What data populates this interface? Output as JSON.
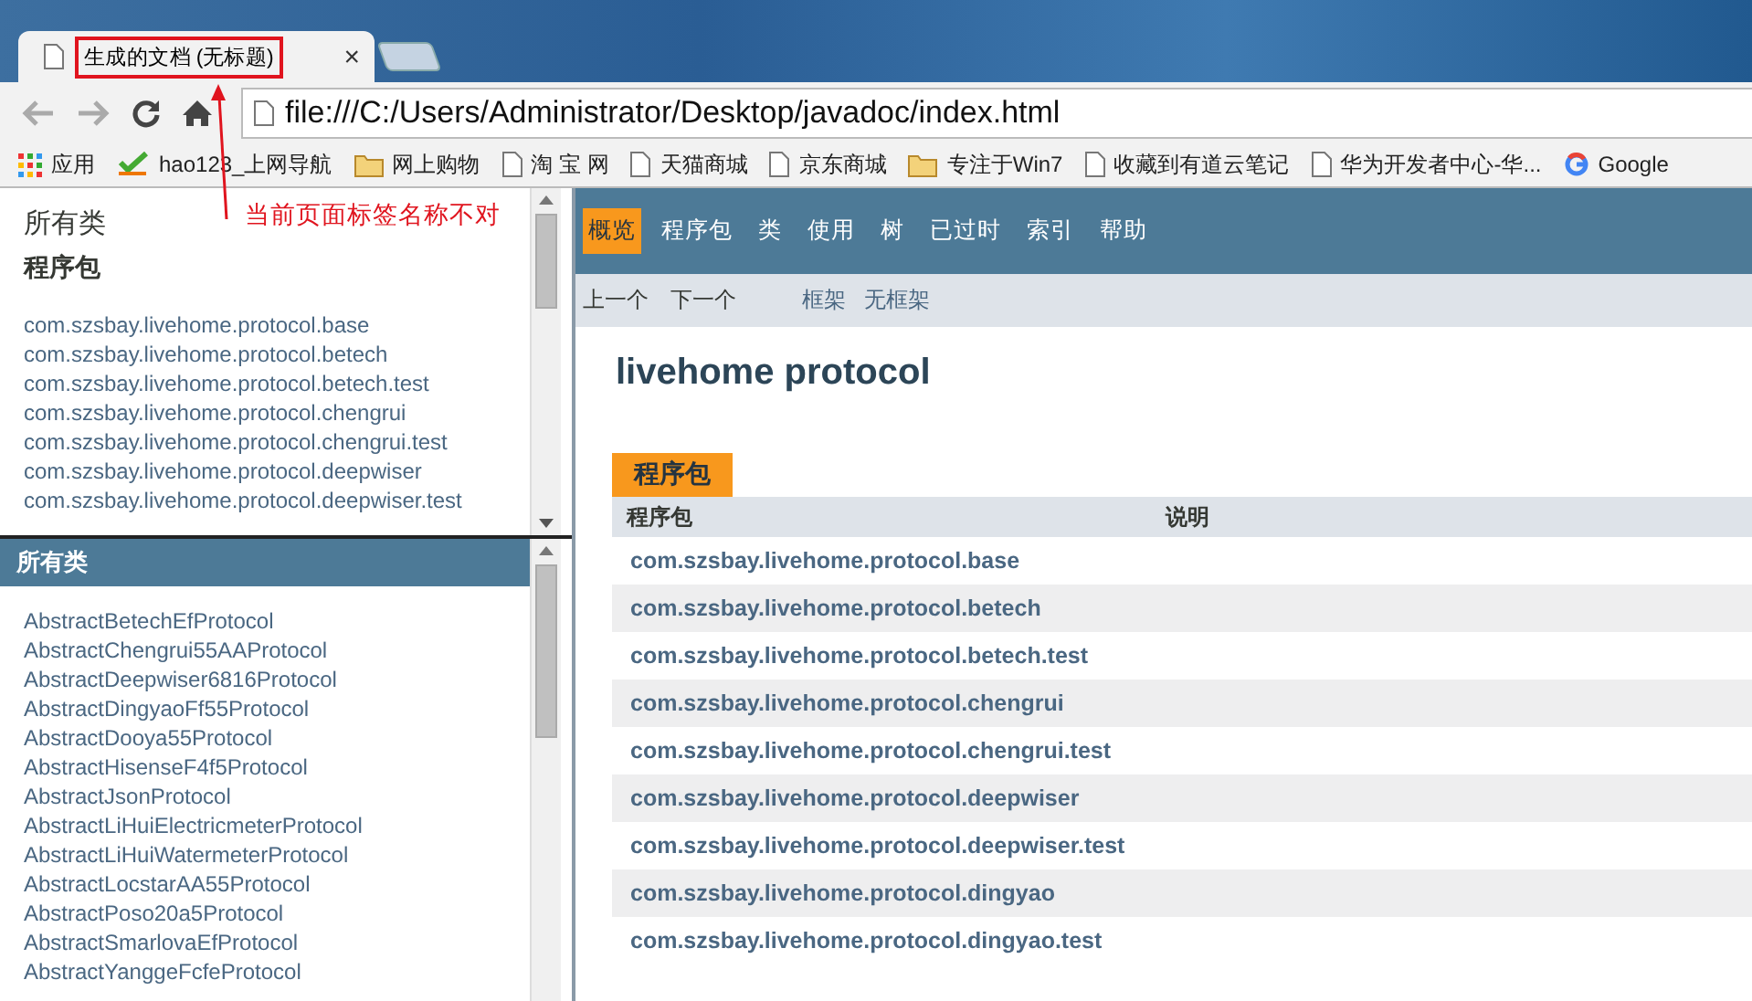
{
  "browser": {
    "tab": {
      "title": "生成的文档 (无标题)",
      "selected": true,
      "close": "×"
    },
    "address": "file:///C:/Users/Administrator/Desktop/javadoc/index.html",
    "bookmarks": [
      {
        "label": "应用",
        "kind": "apps"
      },
      {
        "label": "hao123_上网导航",
        "kind": "hao"
      },
      {
        "label": "网上购物",
        "kind": "folder"
      },
      {
        "label": "淘 宝 网",
        "kind": "page"
      },
      {
        "label": "天猫商城",
        "kind": "page"
      },
      {
        "label": "京东商城",
        "kind": "page"
      },
      {
        "label": "专注于Win7",
        "kind": "folder"
      },
      {
        "label": "收藏到有道云笔记",
        "kind": "page"
      },
      {
        "label": "华为开发者中心-华...",
        "kind": "page"
      },
      {
        "label": "Google",
        "kind": "google"
      }
    ]
  },
  "annotation": {
    "text": "当前页面标签名称不对"
  },
  "package_frame": {
    "title": "所有类",
    "heading": "程序包",
    "packages": [
      "com.szsbay.livehome.protocol.base",
      "com.szsbay.livehome.protocol.betech",
      "com.szsbay.livehome.protocol.betech.test",
      "com.szsbay.livehome.protocol.chengrui",
      "com.szsbay.livehome.protocol.chengrui.test",
      "com.szsbay.livehome.protocol.deepwiser",
      "com.szsbay.livehome.protocol.deepwiser.test"
    ]
  },
  "class_frame": {
    "heading": "所有类",
    "classes": [
      "AbstractBetechEfProtocol",
      "AbstractChengrui55AAProtocol",
      "AbstractDeepwiser6816Protocol",
      "AbstractDingyaoFf55Protocol",
      "AbstractDooya55Protocol",
      "AbstractHisenseF4f5Protocol",
      "AbstractJsonProtocol",
      "AbstractLiHuiElectricmeterProtocol",
      "AbstractLiHuiWatermeterProtocol",
      "AbstractLocstarAA55Protocol",
      "AbstractPoso20a5Protocol",
      "AbstractSmarlovaEfProtocol",
      "AbstractYanggeFcfeProtocol"
    ]
  },
  "main": {
    "nav": [
      {
        "label": "概览",
        "selected": true
      },
      {
        "label": "程序包",
        "selected": false
      },
      {
        "label": "类",
        "selected": false
      },
      {
        "label": "使用",
        "selected": false
      },
      {
        "label": "树",
        "selected": false
      },
      {
        "label": "已过时",
        "selected": false
      },
      {
        "label": "索引",
        "selected": false
      },
      {
        "label": "帮助",
        "selected": false
      }
    ],
    "subnav": [
      {
        "label": "上一个",
        "kind": "text"
      },
      {
        "label": "下一个",
        "kind": "text"
      },
      {
        "label": "框架",
        "kind": "link"
      },
      {
        "label": "无框架",
        "kind": "link"
      }
    ],
    "title": "livehome protocol",
    "table": {
      "caption": "程序包",
      "columns": [
        "程序包",
        "说明"
      ],
      "rows": [
        "com.szsbay.livehome.protocol.base",
        "com.szsbay.livehome.protocol.betech",
        "com.szsbay.livehome.protocol.betech.test",
        "com.szsbay.livehome.protocol.chengrui",
        "com.szsbay.livehome.protocol.chengrui.test",
        "com.szsbay.livehome.protocol.deepwiser",
        "com.szsbay.livehome.protocol.deepwiser.test",
        "com.szsbay.livehome.protocol.dingyao",
        "com.szsbay.livehome.protocol.dingyao.test"
      ]
    }
  }
}
